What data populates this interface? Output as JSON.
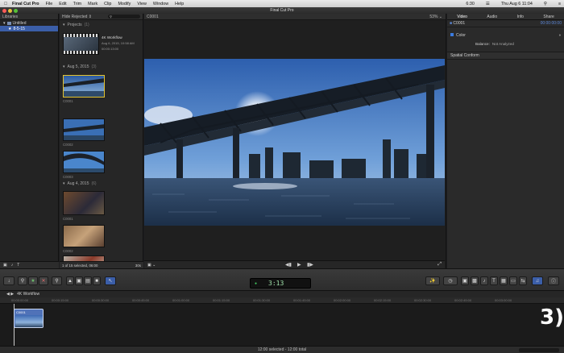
{
  "menubar": {
    "app": "Final Cut Pro",
    "items": [
      "File",
      "Edit",
      "Trim",
      "Mark",
      "Clip",
      "Modify",
      "View",
      "Window",
      "Help"
    ],
    "clock": "Thu Aug 6  11:04",
    "time_small": "6:30"
  },
  "window": {
    "title": "Final Cut Pro"
  },
  "libraries": {
    "header": "Libraries",
    "items": [
      {
        "label": "Untitled"
      },
      {
        "label": "8-5-15"
      }
    ]
  },
  "browser": {
    "filter": "Hide Rejected",
    "projects_label": "Projects",
    "projects_count": "(1)",
    "project": {
      "name": "4K Workflow",
      "date": "Aug 6, 2015, 10:58 AM",
      "duration": "00:00:13:00"
    },
    "groups": [
      {
        "label": "Aug 5, 2015",
        "count": "(3)",
        "clips": [
          "C0001",
          "C0002",
          "C0003"
        ]
      },
      {
        "label": "Aug 4, 2015",
        "count": "(6)",
        "clips": [
          "C0001",
          "C0002",
          "C0003"
        ]
      }
    ],
    "status": "1 of 15 selected, 06:00",
    "zoom": "30s"
  },
  "viewer": {
    "clip": "C0001",
    "zoom": "53%"
  },
  "inspector": {
    "tabs": [
      "Video",
      "Audio",
      "Info",
      "Share"
    ],
    "clip": "C0001",
    "timecode": "00:00:00:00",
    "color_label": "Color",
    "balance_label": "Balance:",
    "balance_value": "Not Analyzed",
    "spatial_label": "Spatial Conform"
  },
  "toolbar": {
    "timecode": "3:13"
  },
  "timeline": {
    "project": "4K Workflow",
    "clip": "C0001",
    "ticks": [
      "00:00:00:00",
      "00:00:15:00",
      "00:00:30:00",
      "00:00:45:00",
      "00:01:00:00",
      "00:01:15:00",
      "00:01:30:00",
      "00:01:45:00",
      "00:02:00:00",
      "00:02:15:00",
      "00:02:30:00",
      "00:02:45:00",
      "00:03:00:00"
    ],
    "overlay_number": "3)"
  },
  "footer": {
    "status": "12:00 selected - 12:00 total"
  },
  "colors": {
    "accent": "#3b5ea8",
    "selection": "#e3c22d",
    "record_green": "#42c860"
  }
}
